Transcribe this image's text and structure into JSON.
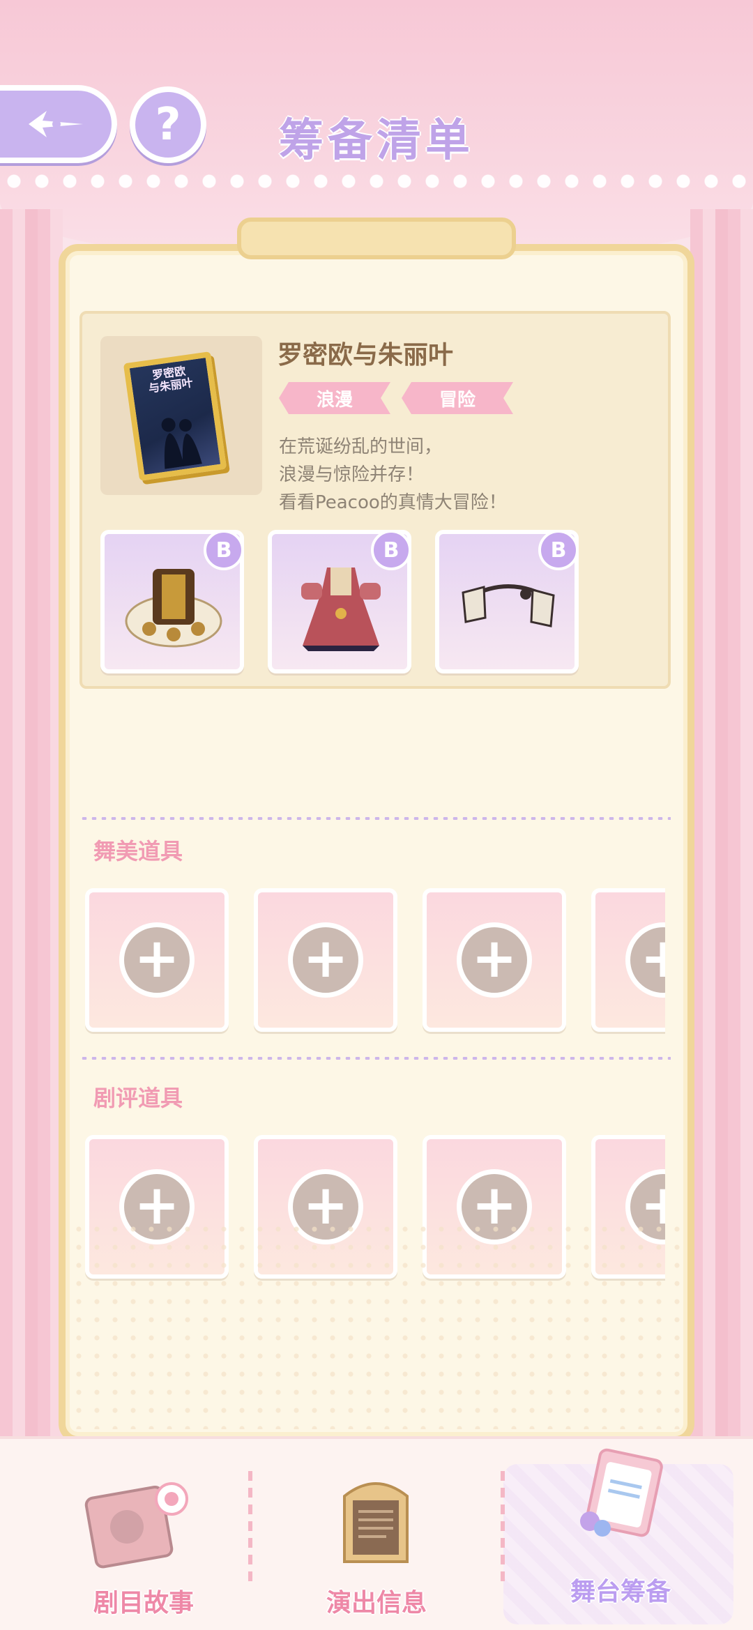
{
  "header": {
    "title": "筹备清单",
    "help_symbol": "?"
  },
  "script": {
    "title": "罗密欧与朱丽叶",
    "cover_title": "罗密欧\n与朱丽叶",
    "tags": [
      "浪漫",
      "冒险"
    ],
    "description": [
      "在荒诞纷乱的世间，",
      "浪漫与惊险并存！",
      "看看Peacoo的真情大冒险！"
    ],
    "items": [
      {
        "grade": "B",
        "icon": "costume-accessory-icon"
      },
      {
        "grade": "B",
        "icon": "dress-icon"
      },
      {
        "grade": "B",
        "icon": "headpiece-icon"
      }
    ]
  },
  "sections": {
    "stage_props_label": "舞美道具",
    "review_props_label": "剧评道具",
    "plus_symbol": "+"
  },
  "bottom_nav": {
    "items": [
      {
        "label": "剧目故事",
        "icon": "story-book-icon"
      },
      {
        "label": "演出信息",
        "icon": "info-board-icon"
      },
      {
        "label": "舞台筹备",
        "icon": "clipboard-icon"
      }
    ],
    "active_index": 2
  },
  "colors": {
    "accent_purple": "#bfa3e8",
    "accent_pink": "#f19bb3",
    "board_border": "#f0d69a"
  }
}
